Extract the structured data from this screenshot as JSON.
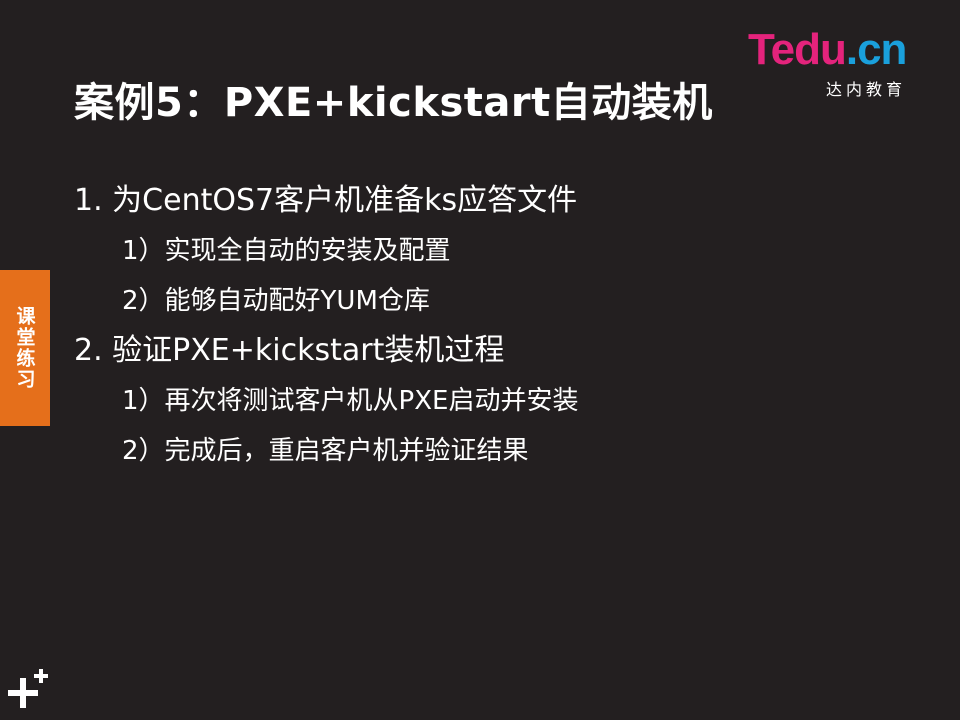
{
  "slide": {
    "title": "案例5：PXE+kickstart自动装机"
  },
  "logo": {
    "brand": "Tedu",
    "domain": ".cn",
    "tagline": "达内教育",
    "colors": {
      "brand": "#e4237c",
      "domain": "#1aa0dc"
    }
  },
  "content": {
    "items": [
      {
        "text": "1. 为CentOS7客户机准备ks应答文件",
        "subitems": [
          "1）实现全自动的安装及配置",
          "2）能够自动配好YUM仓库"
        ]
      },
      {
        "text": "2. 验证PXE+kickstart装机过程",
        "subitems": [
          "1）再次将测试客户机从PXE启动并安装",
          "2）完成后，重启客户机并验证结果"
        ]
      }
    ]
  },
  "side_tab": {
    "label": "课堂练习",
    "color": "#e56f1b"
  },
  "decor": {
    "corner_icon": "plus-icon"
  }
}
